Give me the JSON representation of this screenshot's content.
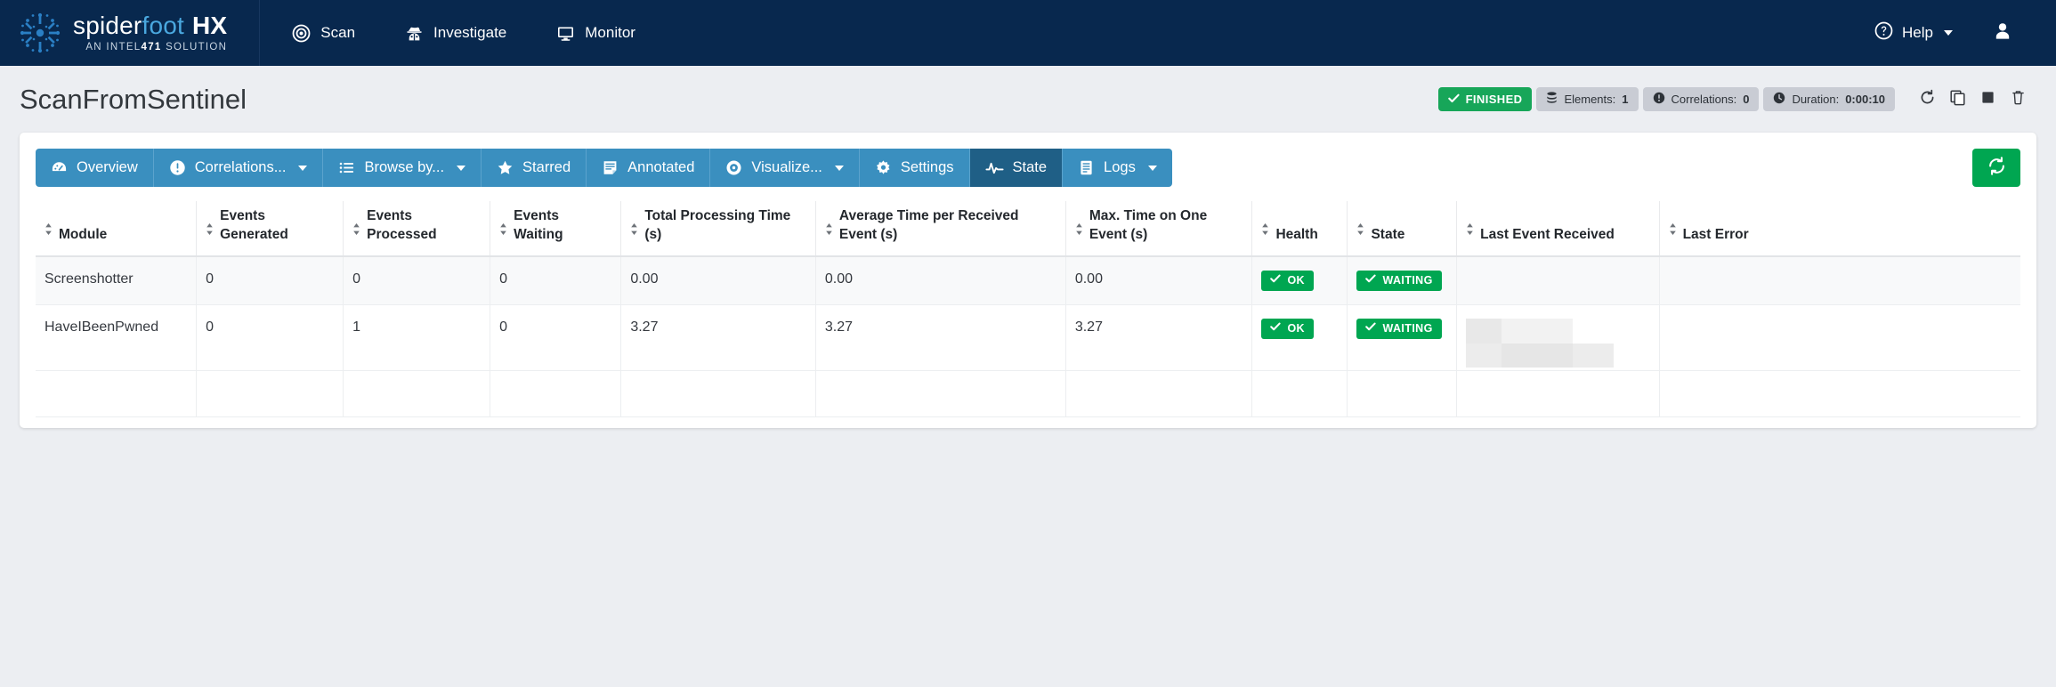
{
  "brand": {
    "word1": "spider",
    "word2": "foot",
    "word3": "HX",
    "tagline_pre": "AN INTEL",
    "tagline_bold": "471",
    "tagline_post": " SOLUTION",
    "logo_icon": "spiderfoot-logo-icon"
  },
  "nav": {
    "items": [
      {
        "label": "Scan",
        "icon": "target-icon"
      },
      {
        "label": "Investigate",
        "icon": "user-secret-icon"
      },
      {
        "label": "Monitor",
        "icon": "desktop-icon"
      }
    ],
    "help_label": "Help",
    "help_icon": "question-circle-icon",
    "user_icon": "user-icon"
  },
  "scan": {
    "title": "ScanFromSentinel",
    "status_label": "FINISHED",
    "status_icon": "check-icon",
    "status_color": "#17a659",
    "badges": [
      {
        "icon": "database-icon",
        "label": "Elements:",
        "value": "1"
      },
      {
        "icon": "exclamation-circle-icon",
        "label": "Correlations:",
        "value": "0"
      },
      {
        "icon": "clock-icon",
        "label": "Duration:",
        "value": "0:00:10"
      }
    ],
    "actions": [
      {
        "name": "rerun-scan-button",
        "icon": "refresh-icon"
      },
      {
        "name": "clone-scan-button",
        "icon": "copy-icon"
      },
      {
        "name": "stop-scan-button",
        "icon": "stop-icon"
      },
      {
        "name": "delete-scan-button",
        "icon": "trash-icon"
      }
    ]
  },
  "tabs": [
    {
      "label": "Overview",
      "icon": "dashboard-icon",
      "active": false,
      "caret": false
    },
    {
      "label": "Correlations...",
      "icon": "exclamation-circle-icon",
      "active": false,
      "caret": true
    },
    {
      "label": "Browse by...",
      "icon": "list-icon",
      "active": false,
      "caret": true
    },
    {
      "label": "Starred",
      "icon": "star-icon",
      "active": false,
      "caret": false
    },
    {
      "label": "Annotated",
      "icon": "note-icon",
      "active": false,
      "caret": false
    },
    {
      "label": "Visualize...",
      "icon": "eye-icon",
      "active": false,
      "caret": true
    },
    {
      "label": "Settings",
      "icon": "gear-icon",
      "active": false,
      "caret": false
    },
    {
      "label": "State",
      "icon": "pulse-icon",
      "active": true,
      "caret": false
    },
    {
      "label": "Logs",
      "icon": "book-icon",
      "active": false,
      "caret": true
    }
  ],
  "refresh_button": {
    "name": "refresh-table-button",
    "icon": "sync-icon",
    "color": "#00a651"
  },
  "table": {
    "columns": [
      "Module",
      "Events Generated",
      "Events Processed",
      "Events Waiting",
      "Total Processing Time (s)",
      "Average Time per Received Event (s)",
      "Max. Time on One Event (s)",
      "Health",
      "State",
      "Last Event Received",
      "Last Error"
    ],
    "rows": [
      {
        "module": "Screenshotter",
        "events_generated": "0",
        "events_processed": "0",
        "events_waiting": "0",
        "total_processing_time": "0.00",
        "avg_time_per_event": "0.00",
        "max_time_one_event": "0.00",
        "health": "OK",
        "state": "WAITING",
        "last_event_received": "",
        "last_error": ""
      },
      {
        "module": "HaveIBeenPwned",
        "events_generated": "0",
        "events_processed": "1",
        "events_waiting": "0",
        "total_processing_time": "3.27",
        "avg_time_per_event": "3.27",
        "max_time_one_event": "3.27",
        "health": "OK",
        "state": "WAITING",
        "last_event_received": "[redacted]",
        "last_error": ""
      }
    ]
  }
}
